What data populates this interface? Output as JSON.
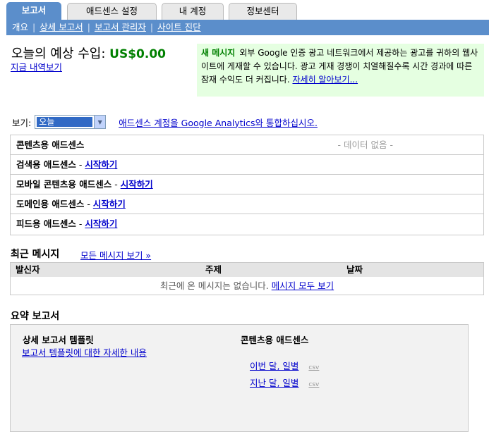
{
  "tabs": [
    {
      "label": "보고서",
      "active": true
    },
    {
      "label": "애드센스 설정",
      "active": false
    },
    {
      "label": "내 계정",
      "active": false
    },
    {
      "label": "정보센터",
      "active": false
    }
  ],
  "subnav": {
    "overview": "개요",
    "detailed_reports": "상세 보고서",
    "report_manager": "보고서 관리자",
    "site_diagnostics": "사이트 진단"
  },
  "estimate": {
    "label": "오늘의 예상 수입:",
    "amount": "US$0.00",
    "view_earnings_link": "지금 내역보기"
  },
  "new_message": {
    "label": "새 메시지",
    "text": "외부 Google 인증 광고 네트워크에서 제공하는 광고를 귀하의 웹사이트에 게재할 수 있습니다. 광고 게재 경쟁이 치열해질수록 시간 경과에 따른 잠재 수익도 더 커집니다. ",
    "link": "자세히 알아보기..."
  },
  "view": {
    "label": "보기:",
    "selected": "오늘",
    "analytics_link": "애드센스 계정을 Google Analytics와 통합하십시오."
  },
  "products": {
    "content": {
      "name": "콘텐츠용 애드센스",
      "status": "- 데이터 없음 -"
    },
    "search": {
      "name": "검색용 애드센스",
      "sep": " - ",
      "link": "시작하기"
    },
    "mobile": {
      "name": "모바일 콘텐츠용 애드센스",
      "sep": " - ",
      "link": "시작하기"
    },
    "domains": {
      "name": "도메인용 애드센스",
      "sep": " - ",
      "link": "시작하기"
    },
    "feeds": {
      "name": "피드용 애드센스",
      "sep": " - ",
      "link": "시작하기"
    }
  },
  "recent_messages": {
    "title": "최근 메시지",
    "view_all_link": "모든 메시지 보기 »",
    "columns": [
      "발신자",
      "주제",
      "날짜"
    ],
    "empty_text": "최근에 온 메시지는 없습니다. ",
    "view_all_messages_link": "메시지 모두 보기"
  },
  "summary": {
    "title": "요약 보고서",
    "template_title": "상세 보고서 템플릿",
    "template_link": "보고서 템플릿에 대한 자세한 내용",
    "content_title": "콘텐츠용 애드센스",
    "reports": [
      {
        "label": "이번 달, 일별",
        "csv": "csv"
      },
      {
        "label": "지난 달, 일별",
        "csv": "csv"
      }
    ]
  },
  "colors": {
    "tab_active": "#5b8ecb",
    "amount": "#008000",
    "message_bg": "#e5ffe1",
    "link": "#0000cc"
  }
}
